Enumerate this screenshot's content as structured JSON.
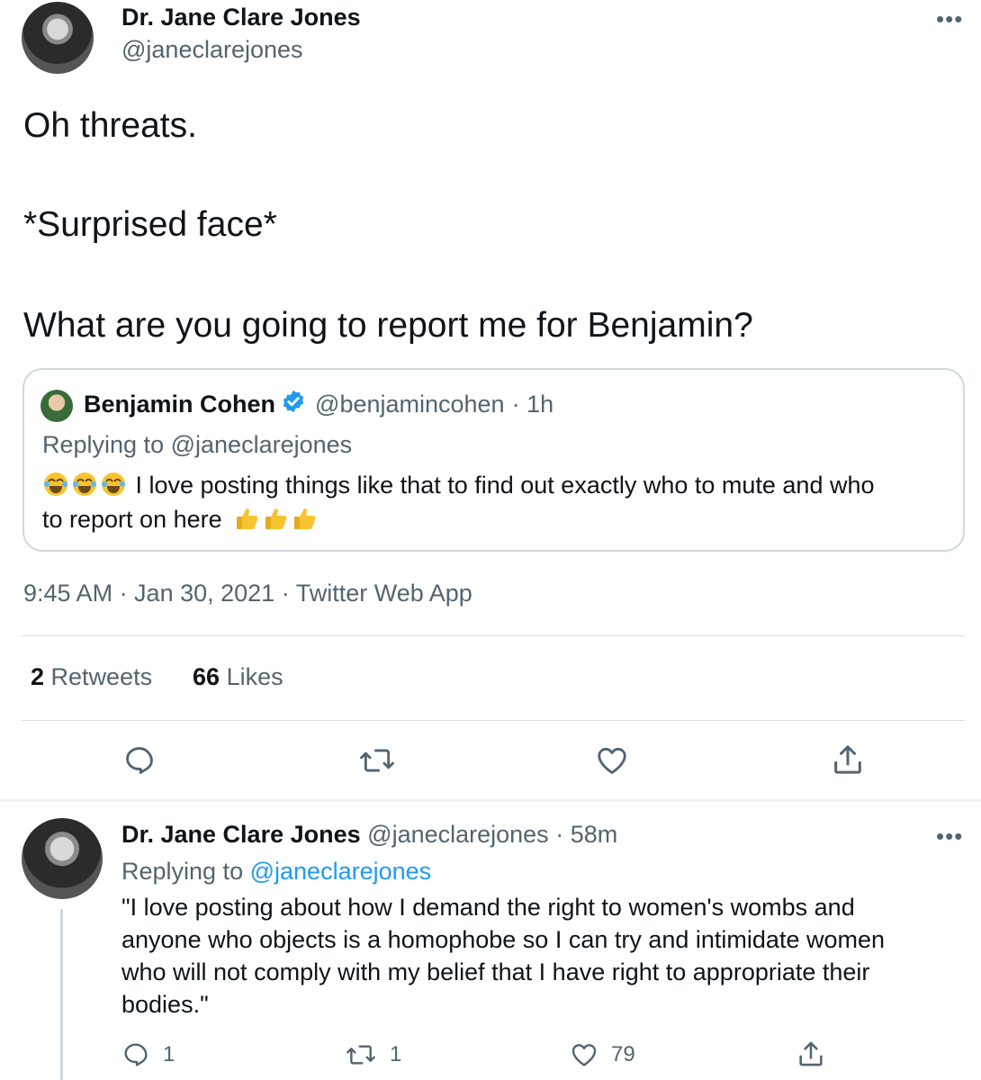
{
  "main_tweet": {
    "author_name": "Dr. Jane Clare Jones",
    "author_handle": "@janeclarejones",
    "more_label": "•••",
    "lines": [
      "Oh threats.",
      "*Surprised face*",
      "What are you going to report me for Benjamin?"
    ],
    "quoted": {
      "author_name": "Benjamin Cohen",
      "author_handle": "@benjamincohen",
      "time": "· 1h",
      "replying_prefix": "Replying to",
      "replying_handle": "@janeclarejones",
      "text_line1": "I love posting things like that to find out exactly who to mute and who",
      "text_line2": "to report on here"
    },
    "timestamp": "9:45 AM · Jan 30, 2021 · Twitter Web App",
    "retweets_count": "2",
    "retweets_label": "Retweets",
    "likes_count": "66",
    "likes_label": "Likes"
  },
  "reply_tweet": {
    "author_name": "Dr. Jane Clare Jones",
    "author_handle": "@janeclarejones",
    "time": "· 58m",
    "more_label": "•••",
    "replying_prefix": "Replying to",
    "replying_handle": "@janeclarejones",
    "lines": [
      "\"I love posting about how I demand the right to women's wombs and",
      "anyone who objects is a homophobe so I can try and intimidate women",
      "who will not comply with my belief that I have right to appropriate their",
      "bodies.\""
    ],
    "reply_count": "1",
    "retweet_count": "1",
    "like_count": "79"
  },
  "icons": [
    "reply-icon",
    "retweet-icon",
    "like-icon",
    "share-icon",
    "verified-badge-icon",
    "joy-emoji-icon",
    "thumbs-up-emoji-icon",
    "more-icon"
  ],
  "colors": {
    "link": "#1d9bf0",
    "verified": "#1d9bf0",
    "emoji": "#f7c431",
    "secondary": "#536471"
  }
}
